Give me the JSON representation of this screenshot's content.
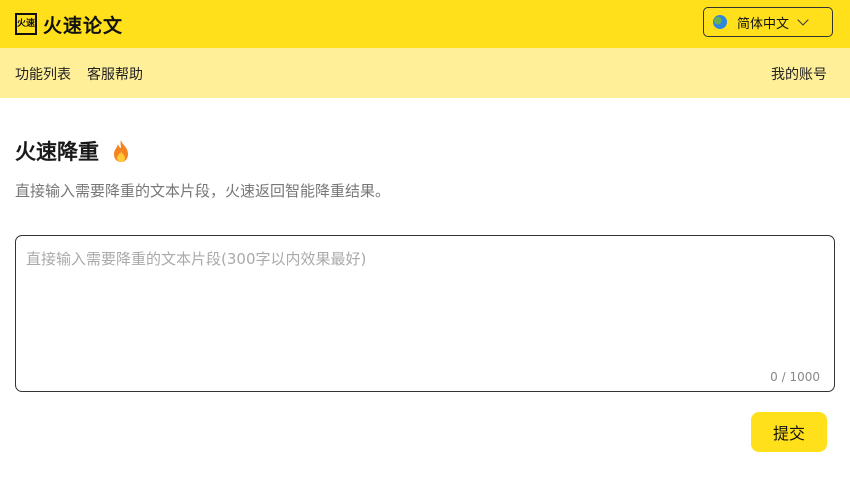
{
  "header": {
    "logo_mark": "火速",
    "logo_text": "火速论文",
    "language": {
      "label": "简体中文",
      "icon": "globe-icon"
    },
    "brand_color": "#ffe01a"
  },
  "subnav": {
    "features": "功能列表",
    "support": "客服帮助",
    "account": "我的账号",
    "background": "#ffef99"
  },
  "main": {
    "title": "火速降重",
    "title_icon": "fire-icon",
    "description": "直接输入需要降重的文本片段，火速返回智能降重结果。",
    "input": {
      "value": "",
      "placeholder": "直接输入需要降重的文本片段(300字以内效果最好)",
      "counter": "0 / 1000"
    },
    "submit_label": "提交"
  }
}
